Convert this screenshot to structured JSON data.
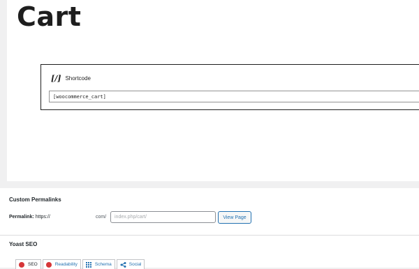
{
  "page": {
    "title": "Cart"
  },
  "shortcode": {
    "icon": "[/]",
    "label": "Shortcode",
    "value": "[woocommerce_cart]"
  },
  "permalinks": {
    "title": "Custom Permalinks",
    "label": "Permalink:",
    "prefix": "https://",
    "mid": "com/",
    "input_value": "index.php/cart/",
    "view_button": "View Page"
  },
  "yoast": {
    "title": "Yoast SEO",
    "tabs": [
      {
        "label": "SEO",
        "icon": "red-dot-icon"
      },
      {
        "label": "Readability",
        "icon": "red-dot-icon"
      },
      {
        "label": "Schema",
        "icon": "grid-icon"
      },
      {
        "label": "Social",
        "icon": "share-icon"
      }
    ],
    "colors": {
      "status_bad": "#d63638",
      "link": "#2271b1"
    }
  }
}
